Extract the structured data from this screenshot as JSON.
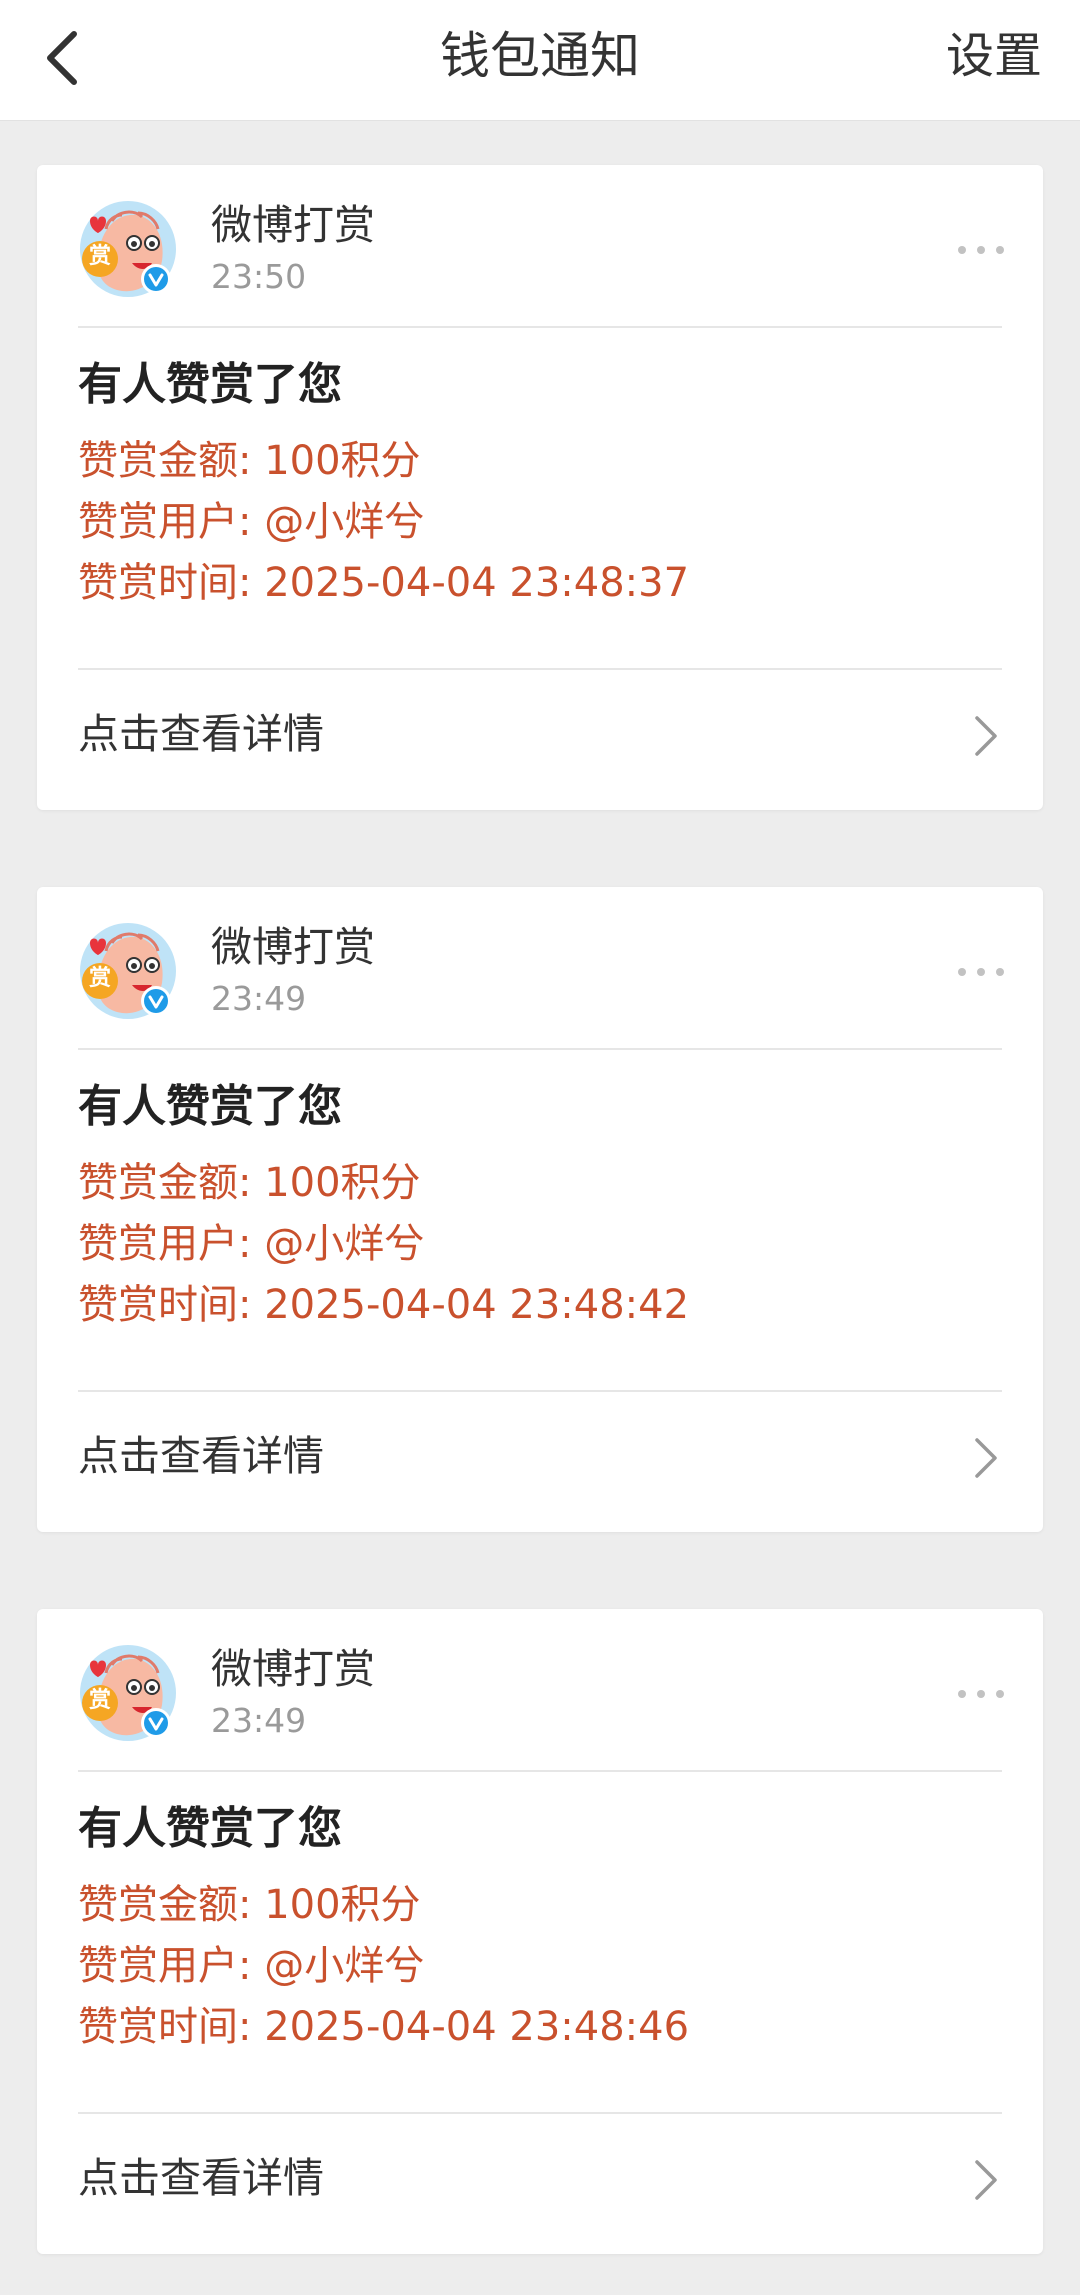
{
  "header": {
    "title": "钱包通知",
    "settings_label": "设置"
  },
  "colors": {
    "accent_text": "#c9512d",
    "verified_badge": "#1f9be8",
    "background": "#ededed"
  },
  "notifications": [
    {
      "sender": "微博打赏",
      "time": "23:50",
      "title": "有人赞赏了您",
      "amount": "赞赏金额: 100积分",
      "user": "赞赏用户: @小烊兮",
      "reward_time": "赞赏时间: 2025-04-04 23:48:37",
      "action": "点击查看详情",
      "avatar_badge": "赏"
    },
    {
      "sender": "微博打赏",
      "time": "23:49",
      "title": "有人赞赏了您",
      "amount": "赞赏金额: 100积分",
      "user": "赞赏用户: @小烊兮",
      "reward_time": "赞赏时间: 2025-04-04 23:48:42",
      "action": "点击查看详情",
      "avatar_badge": "赏"
    },
    {
      "sender": "微博打赏",
      "time": "23:49",
      "title": "有人赞赏了您",
      "amount": "赞赏金额: 100积分",
      "user": "赞赏用户: @小烊兮",
      "reward_time": "赞赏时间: 2025-04-04 23:48:46",
      "action": "点击查看详情",
      "avatar_badge": "赏"
    }
  ]
}
